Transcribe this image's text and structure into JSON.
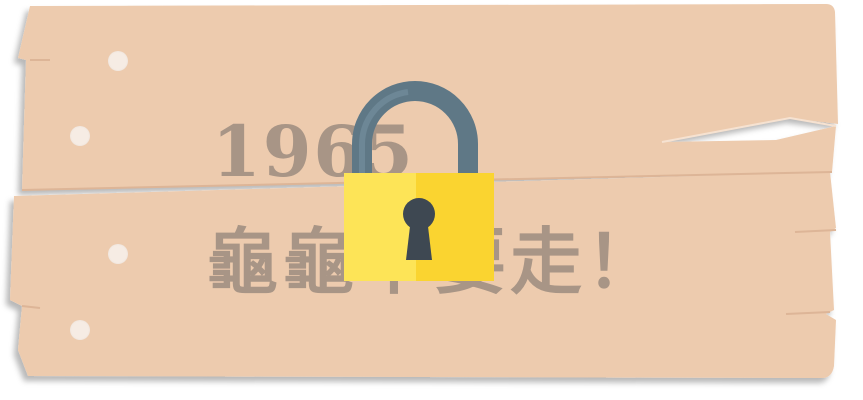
{
  "level_card": {
    "year_label": "1965",
    "title_label": "龜龜不要走！",
    "locked": true,
    "lock_icon": "padlock-icon"
  },
  "colors": {
    "wood": "#edcbae",
    "wood_line": "#ddb597",
    "title_text": "#9a8a7e",
    "lock_body_left": "#fde457",
    "lock_body_right": "#fad430",
    "lock_shackle": "#5f7886",
    "keyhole": "#3e4852",
    "nail": "#f6ece4"
  }
}
